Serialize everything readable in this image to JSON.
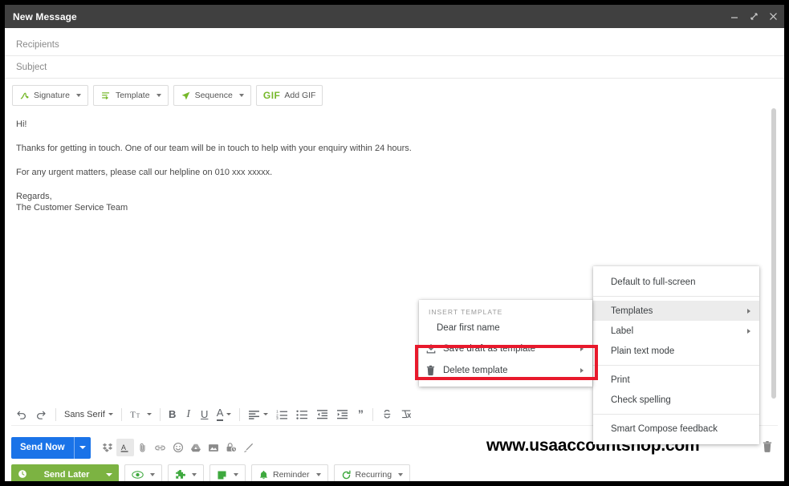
{
  "window": {
    "title": "New Message",
    "controls": [
      {
        "name": "minimize",
        "glyph": "_"
      },
      {
        "name": "expand",
        "glyph": "diagonal"
      },
      {
        "name": "close",
        "glyph": "x"
      }
    ]
  },
  "fields": {
    "recipients_placeholder": "Recipients",
    "subject_placeholder": "Subject"
  },
  "plugin_toolbar": {
    "buttons": [
      {
        "label": "Signature",
        "icon": "signature-icon",
        "caret": true
      },
      {
        "label": "Template",
        "icon": "template-icon",
        "caret": true
      },
      {
        "label": "Sequence",
        "icon": "sequence-icon",
        "caret": true
      },
      {
        "label": "Add GIF",
        "icon": "gif-icon",
        "prefix": "GIF",
        "caret": false
      }
    ]
  },
  "body": {
    "greeting": "Hi!",
    "paragraph1": "Thanks for getting in touch. One of our team will be in touch to help with your enquiry within 24 hours.",
    "paragraph2": "For any urgent matters, please call our helpline on 010 xxx xxxxx.",
    "signoff1": "Regards,",
    "signoff2": "The Customer Service Team"
  },
  "format_toolbar": {
    "undo": "undo-icon",
    "redo": "redo-icon",
    "font_name": "Sans Serif",
    "size_icon": "format-size-icon",
    "bold": "B",
    "italic": "I",
    "underline": "U",
    "text_color": "A",
    "align": "align-icon",
    "numbered_list": "numbered-list-icon",
    "bulleted_list": "bulleted-list-icon",
    "indent_less": "indent-less-icon",
    "indent_more": "indent-more-icon",
    "quote": "quote-icon",
    "strikethrough": "strikethrough-icon",
    "remove_format": "remove-formatting-icon"
  },
  "send_row": {
    "send_now_label": "Send Now",
    "icons": [
      {
        "name": "dropbox-icon"
      },
      {
        "name": "text-format-icon",
        "active": true
      },
      {
        "name": "attach-file-icon"
      },
      {
        "name": "insert-link-icon"
      },
      {
        "name": "insert-emoji-icon"
      },
      {
        "name": "google-drive-icon"
      },
      {
        "name": "insert-photo-icon"
      },
      {
        "name": "confidential-mode-icon"
      },
      {
        "name": "signature-pen-icon"
      }
    ],
    "discard_icon": "trash-icon"
  },
  "bottom_toolbar": {
    "send_later_label": "Send Later",
    "buttons": [
      {
        "label": "",
        "icon": "eye-tracking-icon",
        "caret": true
      },
      {
        "label": "",
        "icon": "puzzle-icon",
        "caret": true
      },
      {
        "label": "",
        "icon": "note-icon",
        "caret": true
      },
      {
        "label": "Reminder",
        "icon": "bell-icon",
        "caret": true
      },
      {
        "label": "Recurring",
        "icon": "recurring-icon",
        "caret": true
      }
    ]
  },
  "insert_template_menu": {
    "header": "INSERT TEMPLATE",
    "items": [
      {
        "label": "Dear first name",
        "icon": null,
        "submenu": false,
        "indent": true
      },
      {
        "label": "Save draft as template",
        "icon": "save-download-icon",
        "submenu": true,
        "highlighted": true
      },
      {
        "label": "Delete template",
        "icon": "trash-icon",
        "submenu": true
      }
    ]
  },
  "more_options_menu": {
    "items": [
      {
        "label": "Default to full-screen",
        "submenu": false,
        "highlighted": false,
        "separator_after": true
      },
      {
        "label": "Templates",
        "submenu": true,
        "highlighted": true
      },
      {
        "label": "Label",
        "submenu": true,
        "highlighted": false
      },
      {
        "label": "Plain text mode",
        "submenu": false,
        "highlighted": false,
        "separator_after": true
      },
      {
        "label": "Print",
        "submenu": false,
        "highlighted": false
      },
      {
        "label": "Check spelling",
        "submenu": false,
        "highlighted": false,
        "separator_after": true
      },
      {
        "label": "Smart Compose feedback",
        "submenu": false,
        "highlighted": false
      }
    ]
  },
  "watermark": "www.usaaccountshop.com",
  "colors": {
    "titlebar": "#404040",
    "send_now": "#1a73e8",
    "send_later": "#7cb342",
    "accent_green": "#76b82a",
    "highlight_red": "#e8192c",
    "menu_highlight": "#ececec"
  }
}
